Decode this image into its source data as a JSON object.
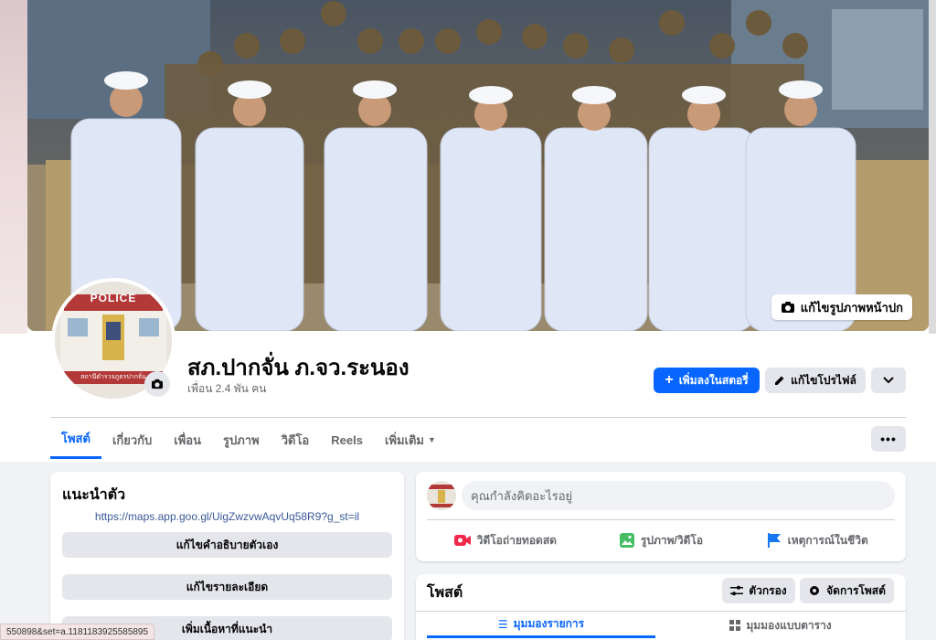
{
  "cover": {
    "edit_label": "แก้ไขรูปภาพหน้าปก"
  },
  "profile": {
    "name": "สภ.ปากจั่น ภ.จว.ระนอง",
    "friends": "เพื่อน 2.4 พัน คน",
    "avatar_sign": "POLICE",
    "avatar_caption": "สถานีตำรวจภูธรปากจั่น"
  },
  "actions": {
    "add_story": "เพิ่มลงในสตอรี่",
    "edit_profile": "แก้ไขโปรไฟล์"
  },
  "tabs": [
    {
      "label": "โพสต์"
    },
    {
      "label": "เกี่ยวกับ"
    },
    {
      "label": "เพื่อน"
    },
    {
      "label": "รูปภาพ"
    },
    {
      "label": "วิดีโอ"
    },
    {
      "label": "Reels"
    },
    {
      "label": "เพิ่มเติม"
    }
  ],
  "intro": {
    "title": "แนะนำตัว",
    "link": "https://maps.app.goo.gl/UigZwzvwAqvUq58R9?g_st=il",
    "buttons": [
      "แก้ไขคำอธิบายตัวเอง",
      "แก้ไขรายละเอียด",
      "เพิ่มเนื้อหาที่แนะนำ"
    ]
  },
  "composer": {
    "placeholder": "คุณกำลังคิดอะไรอยู่",
    "actions": [
      "วิดีโอถ่ายทอดสด",
      "รูปภาพ/วิดีโอ",
      "เหตุการณ์ในชีวิต"
    ]
  },
  "posts": {
    "title": "โพสต์",
    "filter": "ตัวกรอง",
    "manage": "จัดการโพสต์",
    "view_list": "มุมมองรายการ",
    "view_grid": "มุมมองแบบตาราง"
  },
  "status_bar": {
    "url": "550898&set=a.1181183925585895"
  },
  "colors": {
    "primary": "#0866ff",
    "background": "#f0f2f5",
    "live_red": "#f02849",
    "photo_green": "#45bd62",
    "event_blue": "#1877f2"
  }
}
